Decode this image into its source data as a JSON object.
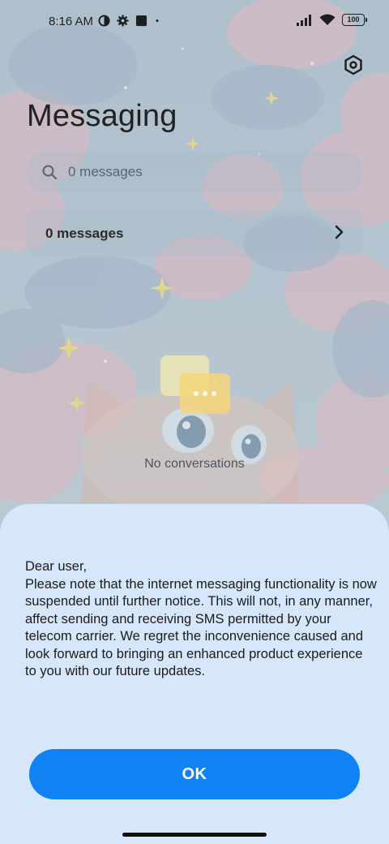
{
  "status_bar": {
    "time": "8:16 AM",
    "battery": "100",
    "left_icons": [
      "vpn-half-circle-icon",
      "gear-icon",
      "square-notification-icon",
      "dot-icon"
    ],
    "right_icons": [
      "signal-icon",
      "wifi-icon",
      "battery-icon"
    ]
  },
  "header": {
    "title": "Messaging",
    "settings_icon": "settings-hexagon-icon"
  },
  "search": {
    "placeholder": "0 messages"
  },
  "messages_row": {
    "label": "0 messages"
  },
  "empty_state": {
    "label": "No conversations",
    "icon": "chat-bubbles-icon",
    "icon_colors": [
      "#f3e7b0",
      "#f4d67a"
    ]
  },
  "dialog": {
    "greeting": "Dear user,",
    "body": "Please note that the internet messaging functionality is now suspended until further notice. This will not, in any manner, affect sending and receiving SMS permitted by your telecom carrier. We regret the inconvenience caused and look forward to bringing an enhanced product experience to you with our future updates.",
    "ok_label": "OK",
    "accent": "#0f83f5",
    "background": "#d6e7fb"
  }
}
